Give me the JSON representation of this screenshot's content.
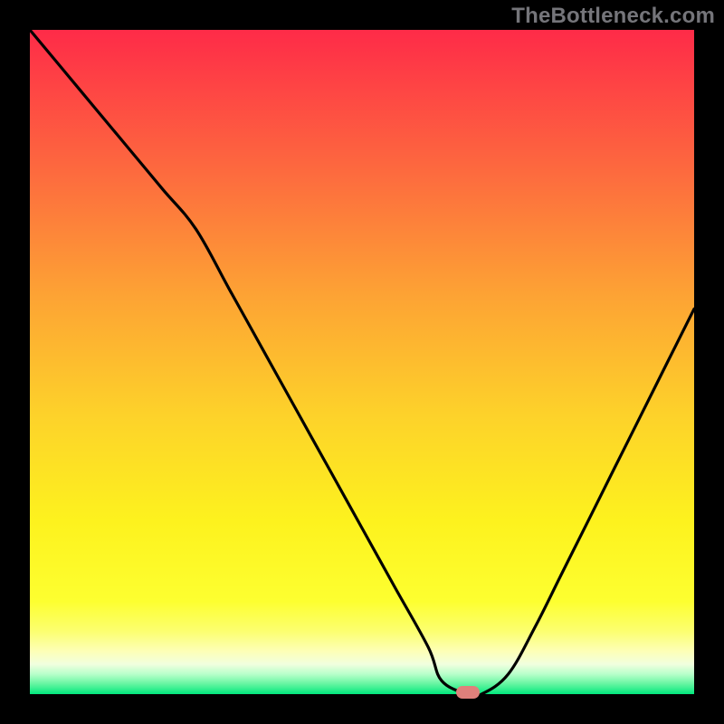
{
  "watermark": {
    "text": "TheBottleneck.com"
  },
  "colors": {
    "frame": "#000000",
    "gradient_top": "#fe2b48",
    "gradient_mid1": "#fd8d3a",
    "gradient_mid2": "#fdd02c",
    "gradient_mid3": "#fdf21e",
    "gradient_band": "#fcff6f",
    "gradient_bottom": "#01e87d",
    "curve": "#000000",
    "marker": "#e0807b",
    "watermark": "#75757a"
  },
  "chart_data": {
    "type": "line",
    "title": "",
    "xlabel": "",
    "ylabel": "",
    "x": [
      0,
      5,
      10,
      15,
      20,
      25,
      30,
      35,
      40,
      45,
      50,
      55,
      60,
      62,
      66,
      68,
      72,
      76,
      80,
      84,
      88,
      92,
      96,
      100
    ],
    "values": [
      100,
      94,
      88,
      82,
      76,
      70,
      61,
      52,
      43,
      34,
      25,
      16,
      7,
      2,
      0,
      0,
      3,
      10,
      18,
      26,
      34,
      42,
      50,
      58
    ],
    "xlim": [
      0,
      100
    ],
    "ylim": [
      0,
      100
    ],
    "marker": {
      "x": 66,
      "y": 0
    },
    "annotations": []
  }
}
